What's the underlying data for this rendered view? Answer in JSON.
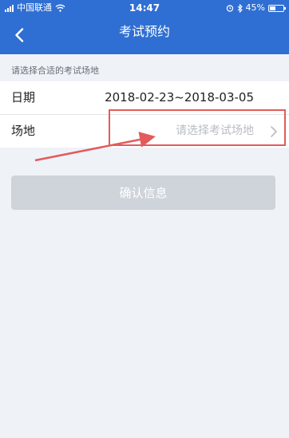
{
  "status_bar": {
    "carrier": "中国联通",
    "time": "14:47",
    "battery": "45%",
    "battery_level": 0.45
  },
  "nav": {
    "title": "考试预约",
    "back_icon": "chevron-left-icon"
  },
  "hint": "请选择合适的考试场地",
  "form": {
    "date_label": "日期",
    "date_value": "2018-02-23~2018-03-05",
    "venue_label": "场地",
    "venue_placeholder": "请选择考试场地"
  },
  "confirm_label": "确认信息",
  "colors": {
    "header_bg": "#2f6fd3",
    "annotation_red": "#e35b5b",
    "button_disabled": "#cfd4da"
  }
}
